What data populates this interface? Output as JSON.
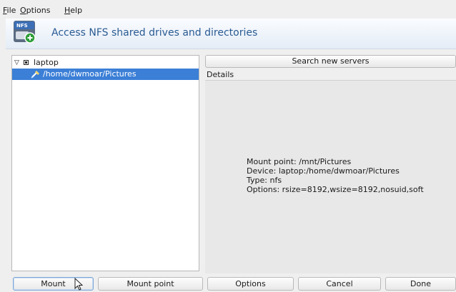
{
  "menubar": {
    "file": {
      "accel": "F",
      "rest": "ile"
    },
    "options": {
      "accel": "O",
      "rest": "ptions"
    },
    "help": {
      "accel": "H",
      "rest": "elp"
    }
  },
  "header": {
    "icon_label": "NFS",
    "title": "Access NFS shared drives and directories"
  },
  "tree": {
    "host": "laptop",
    "share": "/home/dwmoar/Pictures"
  },
  "search_button": "Search new servers",
  "details": {
    "label": "Details",
    "mount_point": "Mount point: /mnt/Pictures",
    "device": "Device: laptop:/home/dwmoar/Pictures",
    "type": "Type: nfs",
    "options": "Options: rsize=8192,wsize=8192,nosuid,soft"
  },
  "buttons": {
    "mount": "Mount",
    "mount_point": "Mount point",
    "options": "Options",
    "cancel": "Cancel",
    "done": "Done"
  },
  "colors": {
    "accent": "#3b7fd6",
    "header_title": "#2a5b93"
  }
}
